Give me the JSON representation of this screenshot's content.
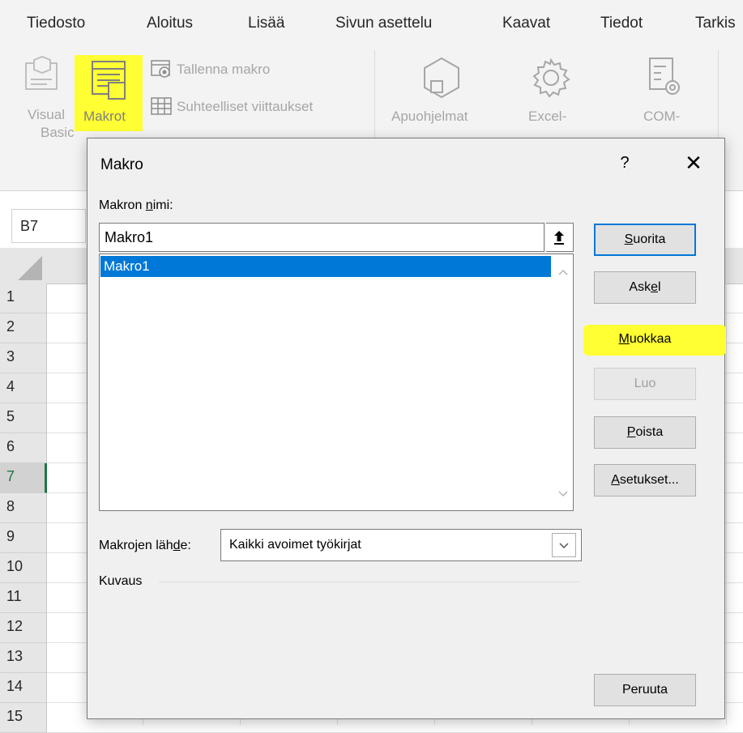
{
  "ribbon": {
    "tabs": [
      "Tiedosto",
      "Aloitus",
      "Lisää",
      "Sivun asettelu",
      "Kaavat",
      "Tiedot",
      "Tarkis"
    ],
    "visual_basic_label_1": "Visual",
    "visual_basic_label_2": "Basic",
    "macros_label": "Makrot",
    "record_macro_label": "Tallenna makro",
    "relative_refs_label": "Suhteelliset viittaukset",
    "addins_label": "Apuohjelmat",
    "excel_addins_label": "Excel-",
    "com_addins_label": "COM-",
    "highlight_color": "#ffff33"
  },
  "namebox": {
    "value": "B7"
  },
  "grid": {
    "rows": [
      "1",
      "2",
      "3",
      "4",
      "5",
      "6",
      "7",
      "8",
      "9",
      "10",
      "11",
      "12",
      "13",
      "14",
      "15"
    ],
    "selected_row": "7",
    "accent": "#217346"
  },
  "dialog": {
    "title": "Makro",
    "help_label": "?",
    "close_label": "✕",
    "name_label_pre": "Makron ",
    "name_label_u": "n",
    "name_label_post": "imi:",
    "name_value": "Makro1",
    "list_items": [
      "Makro1"
    ],
    "buttons": {
      "run_u": "S",
      "run_rest": "uorita",
      "step_pre": "Ask",
      "step_u": "e",
      "step_post": "l",
      "edit_u": "M",
      "edit_rest": "uokkaa",
      "create": "Luo",
      "delete_u": "P",
      "delete_rest": "oista",
      "options_u": "A",
      "options_rest": "setukset...",
      "cancel": "Peruuta"
    },
    "source_label_pre": "Makrojen läh",
    "source_label_u": "d",
    "source_label_post": "e:",
    "source_value": "Kaikki avoimet työkirjat",
    "description_label": "Kuvaus",
    "selection_color": "#0078d7"
  }
}
